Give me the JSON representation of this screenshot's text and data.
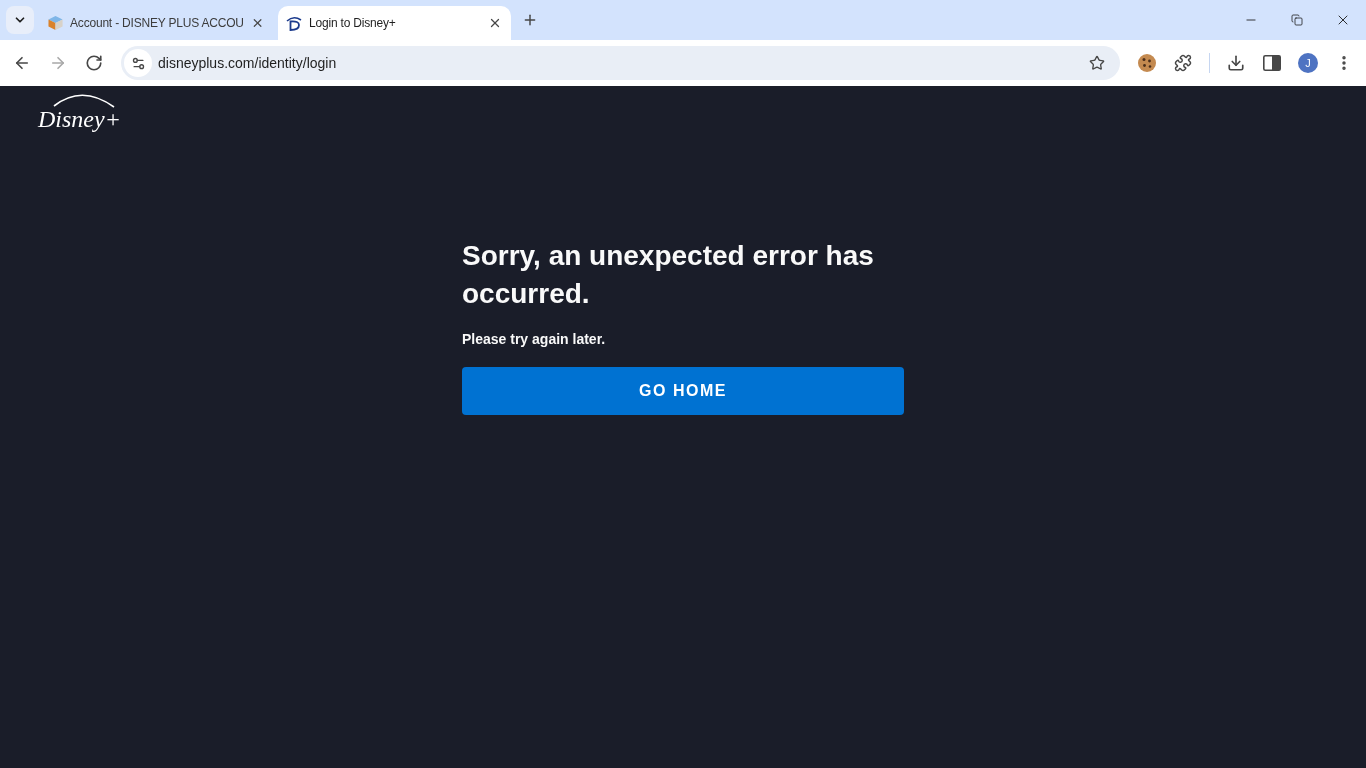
{
  "browser": {
    "tabs": [
      {
        "title": "Account - DISNEY PLUS ACCOU",
        "kind": "cube",
        "selected": false
      },
      {
        "title": "Login to Disney+",
        "kind": "monogram",
        "selected": true
      }
    ],
    "nav_buttons": [
      {
        "kind": "back",
        "disabled": false
      },
      {
        "kind": "forward",
        "disabled": true
      },
      {
        "kind": "reload",
        "disabled": false
      }
    ],
    "address_bar": {
      "url": "disneyplus.com/identity/login"
    },
    "profile": {
      "initial": "J"
    }
  },
  "page": {
    "logo": {
      "text": "Disney+"
    },
    "heading": "Sorry, an unexpected error has occurred.",
    "message": "Please try again later.",
    "button": "GO HOME"
  }
}
